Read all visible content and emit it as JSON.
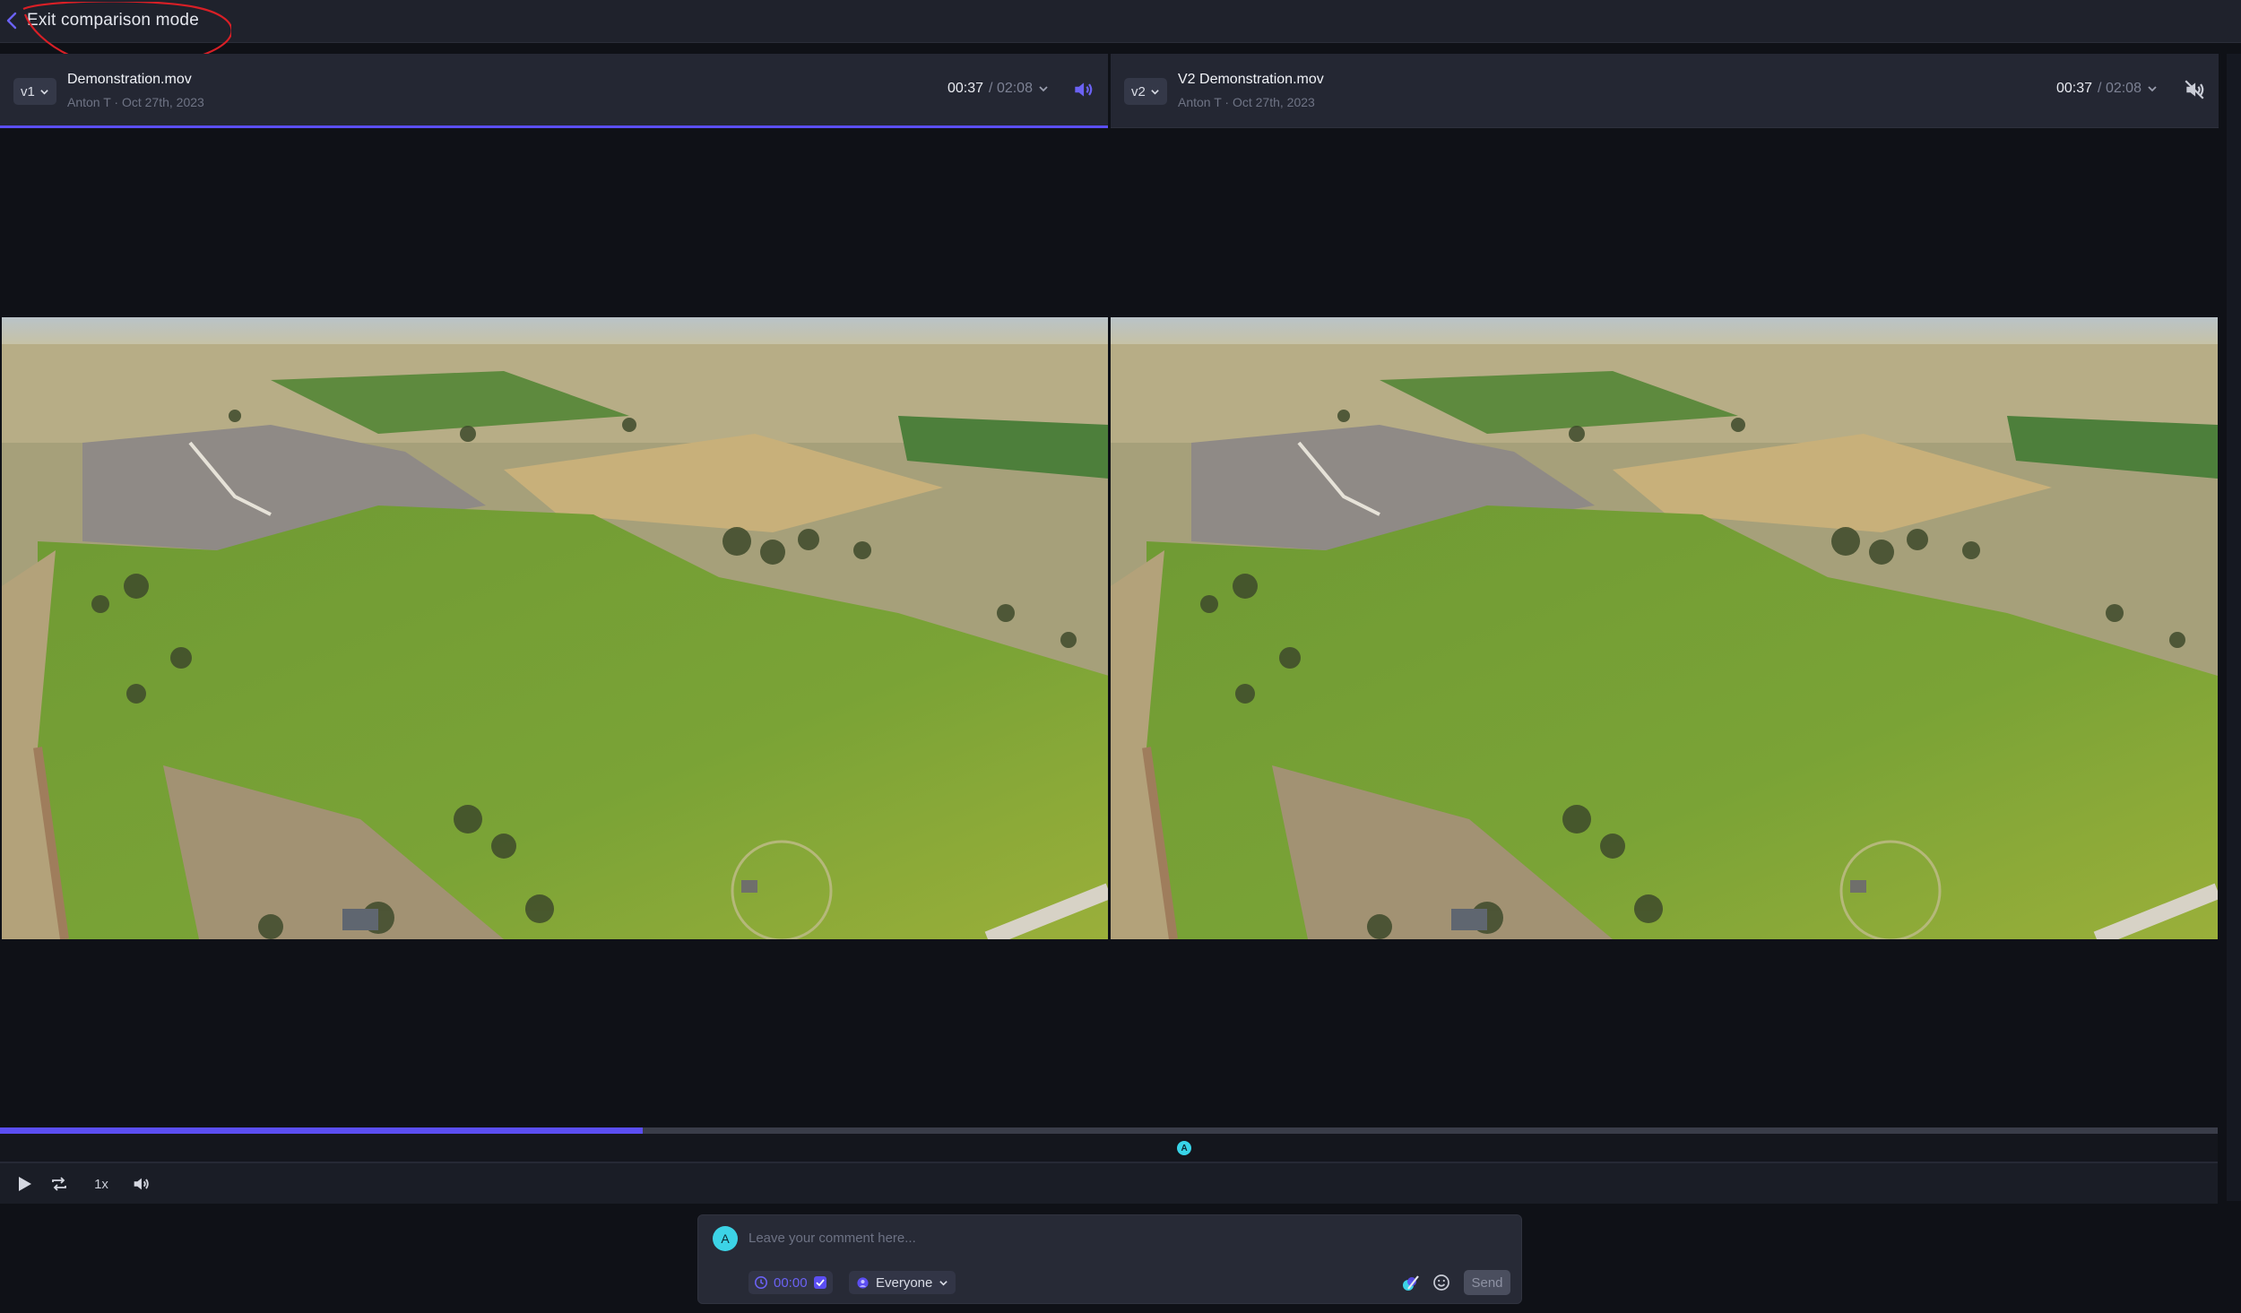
{
  "topbar": {
    "exit_label": "Exit comparison mode"
  },
  "left_panel": {
    "version": "v1",
    "file_name": "Demonstration.mov",
    "meta": "Anton T · Oct 27th, 2023",
    "current_time": "00:37",
    "total_time": "/ 02:08",
    "audio": "on"
  },
  "right_panel": {
    "version": "v2",
    "file_name": "V2 Demonstration.mov",
    "meta": "Anton T · Oct 27th, 2023",
    "current_time": "00:37",
    "total_time": "/ 02:08",
    "audio": "muted"
  },
  "timeline": {
    "progress_fraction": 0.29,
    "marker_fraction": 0.534,
    "marker_initial": "A"
  },
  "controls": {
    "speed_label": "1x"
  },
  "composer": {
    "avatar_initial": "A",
    "placeholder": "Leave your comment here...",
    "timestamp": "00:00",
    "audience": "Everyone",
    "send_label": "Send"
  },
  "colors": {
    "accent": "#5b4ef2",
    "marker": "#38d4e8",
    "background": "#0f1117",
    "panel": "#242733"
  },
  "icons": {
    "exit": "chevron-left-icon",
    "play": "play-icon",
    "loop": "loop-icon",
    "volume": "volume-icon",
    "muted": "volume-muted-icon",
    "clock": "clock-icon",
    "check": "checkbox-icon",
    "audience": "audience-icon",
    "paint": "paint-brush-icon",
    "emoji": "emoji-icon"
  }
}
